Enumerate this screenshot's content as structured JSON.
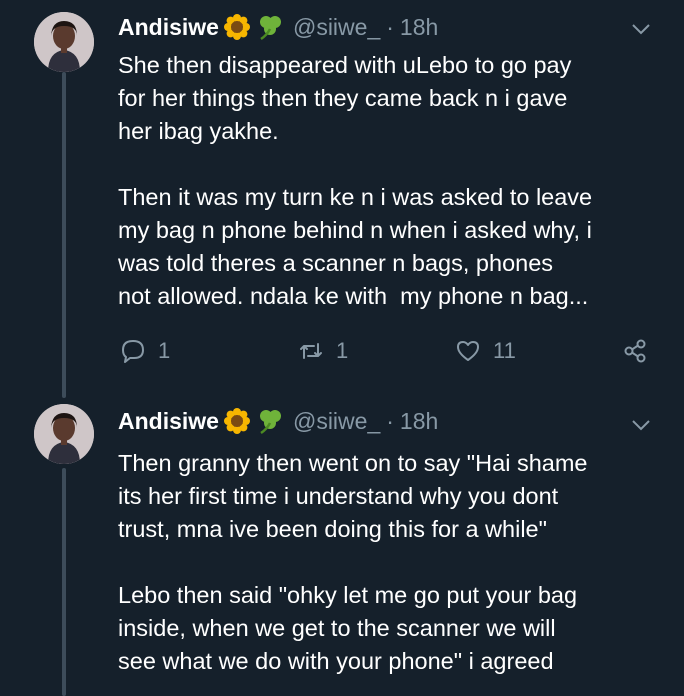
{
  "tweets": [
    {
      "author_name": "Andisiwe",
      "emoji_icons": [
        "sunflower-icon",
        "shamrock-icon"
      ],
      "handle": "@siiwe_",
      "separator": "·",
      "time": "18h",
      "text": "She then disappeared with uLebo to go pay\nfor her things then they came back n i gave\nher ibag yakhe.\n\nThen it was my turn ke n i was asked to leave\nmy bag n phone behind n when i asked why, i\nwas told theres a scanner n bags, phones\nnot allowed. ndala ke with  my phone n bag...",
      "reply_count": "1",
      "retweet_count": "1",
      "like_count": "11"
    },
    {
      "author_name": "Andisiwe",
      "emoji_icons": [
        "sunflower-icon",
        "shamrock-icon"
      ],
      "handle": "@siiwe_",
      "separator": "·",
      "time": "18h",
      "text": "Then granny then went on to say \"Hai shame\nits her first time i understand why you dont\ntrust, mna ive been doing this for a while\"\n\nLebo then said \"ohky let me go put your bag\ninside, when we get to the scanner we will\nsee what we do with your phone\" i agreed"
    }
  ],
  "colors": {
    "background": "#15202b",
    "text_primary": "#ffffff",
    "text_secondary": "#8899a6",
    "thread_line": "#3d4c5a"
  }
}
